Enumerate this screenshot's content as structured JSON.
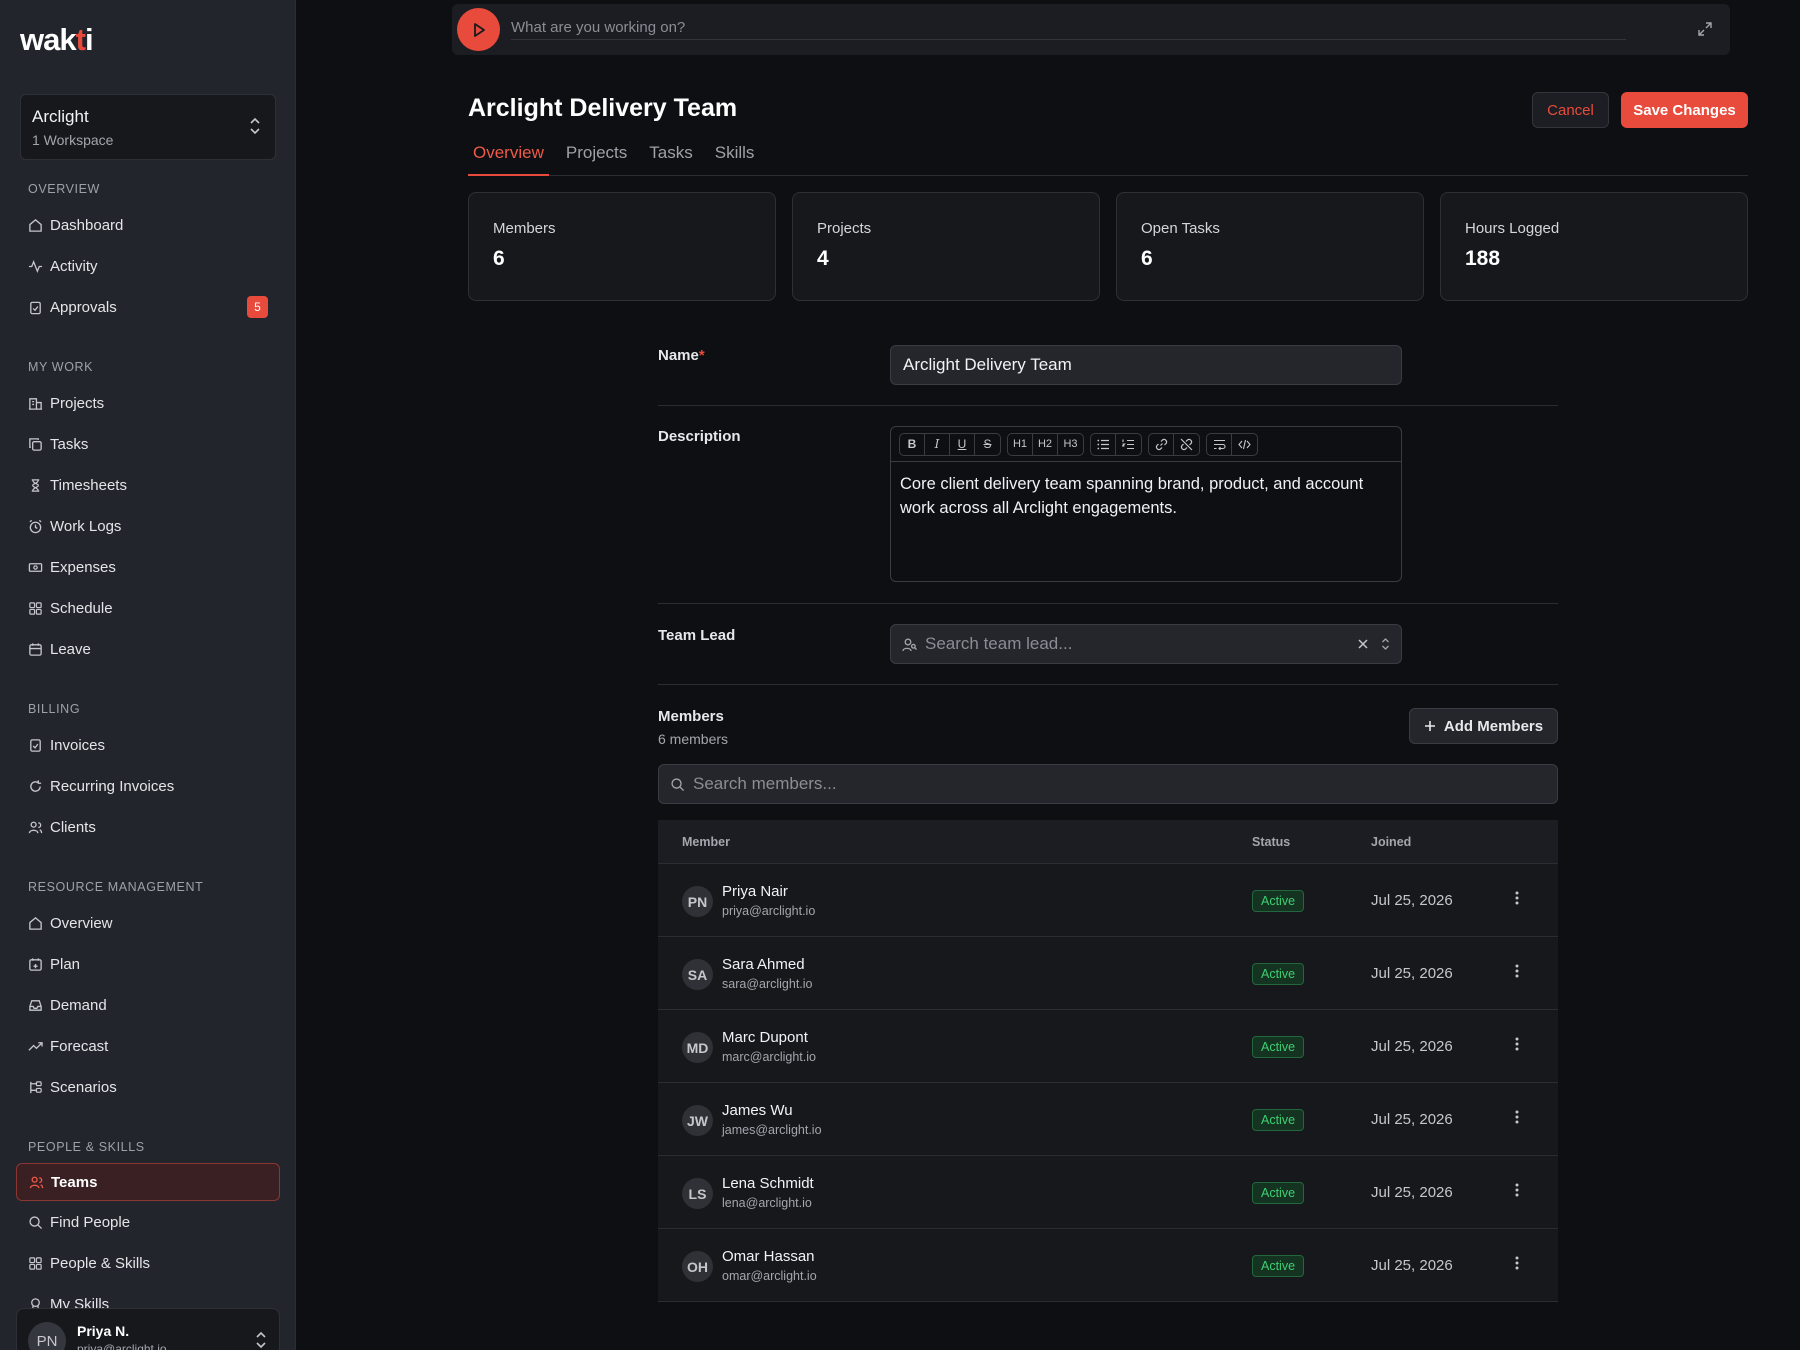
{
  "app": {
    "logo": "wakti"
  },
  "workspace": {
    "name": "Arclight",
    "sub": "1 Workspace"
  },
  "sidebar": {
    "sections": [
      "Overview",
      "My Work",
      "Billing",
      "Resource Management",
      "People & Skills"
    ],
    "items": [
      {
        "label": "Dashboard",
        "icon": "home-icon"
      },
      {
        "label": "Activity",
        "icon": "activity-icon"
      },
      {
        "label": "Approvals",
        "icon": "clipboard-check-icon",
        "badge": "5"
      },
      {
        "label": "Projects",
        "icon": "building-icon"
      },
      {
        "label": "Tasks",
        "icon": "copy-icon"
      },
      {
        "label": "Timesheets",
        "icon": "hourglass-icon"
      },
      {
        "label": "Work Logs",
        "icon": "alarm-clock-icon"
      },
      {
        "label": "Expenses",
        "icon": "banknote-icon"
      },
      {
        "label": "Schedule",
        "icon": "grid-icon"
      },
      {
        "label": "Leave",
        "icon": "calendar-icon"
      },
      {
        "label": "Invoices",
        "icon": "receipt-icon"
      },
      {
        "label": "Recurring Invoices",
        "icon": "refresh-icon"
      },
      {
        "label": "Clients",
        "icon": "users-icon"
      },
      {
        "label": "Overview",
        "icon": "home-icon"
      },
      {
        "label": "Plan",
        "icon": "calendar-plus-icon"
      },
      {
        "label": "Demand",
        "icon": "inbox-icon"
      },
      {
        "label": "Forecast",
        "icon": "trending-up-icon"
      },
      {
        "label": "Scenarios",
        "icon": "git-branch-icon"
      },
      {
        "label": "Teams",
        "icon": "team-icon"
      },
      {
        "label": "Find People",
        "icon": "search-icon"
      },
      {
        "label": "People & Skills",
        "icon": "grid-icon"
      },
      {
        "label": "My Skills",
        "icon": "award-icon"
      }
    ],
    "user": {
      "initials": "PN",
      "name": "Priya N.",
      "email": "priya@arclight.io"
    }
  },
  "timer": {
    "placeholder": "What are you working on?"
  },
  "header": {
    "title": "Arclight Delivery Team",
    "cancel_label": "Cancel",
    "save_label": "Save Changes",
    "tabs": [
      "Overview",
      "Projects",
      "Tasks",
      "Skills"
    ]
  },
  "stats": [
    {
      "label": "Members",
      "value": "6"
    },
    {
      "label": "Projects",
      "value": "4"
    },
    {
      "label": "Open Tasks",
      "value": "6"
    },
    {
      "label": "Hours Logged",
      "value": "188"
    }
  ],
  "form": {
    "name_label": "Name",
    "required_mark": "*",
    "name_value": "Arclight Delivery Team",
    "description_label": "Description",
    "description_value": "Core client delivery team spanning brand, product, and account work across all Arclight engagements.",
    "toolbar": [
      "B",
      "I",
      "U",
      "S",
      "H1",
      "H2",
      "H3",
      "bullet-list",
      "ordered-list",
      "link",
      "unlink",
      "hard-break",
      "code"
    ],
    "team_lead_label": "Team Lead",
    "team_lead_placeholder": "Search team lead..."
  },
  "members": {
    "title": "Members",
    "count_text": "6 members",
    "add_label": "Add Members",
    "search_placeholder": "Search members...",
    "columns": [
      "Member",
      "Status",
      "Joined"
    ],
    "rows": [
      {
        "initials": "PN",
        "name": "Priya Nair",
        "email": "priya@arclight.io",
        "status": "Active",
        "joined": "Jul 25, 2026"
      },
      {
        "initials": "SA",
        "name": "Sara Ahmed",
        "email": "sara@arclight.io",
        "status": "Active",
        "joined": "Jul 25, 2026"
      },
      {
        "initials": "MD",
        "name": "Marc Dupont",
        "email": "marc@arclight.io",
        "status": "Active",
        "joined": "Jul 25, 2026"
      },
      {
        "initials": "JW",
        "name": "James Wu",
        "email": "james@arclight.io",
        "status": "Active",
        "joined": "Jul 25, 2026"
      },
      {
        "initials": "LS",
        "name": "Lena Schmidt",
        "email": "lena@arclight.io",
        "status": "Active",
        "joined": "Jul 25, 2026"
      },
      {
        "initials": "OH",
        "name": "Omar Hassan",
        "email": "omar@arclight.io",
        "status": "Active",
        "joined": "Jul 25, 2026"
      }
    ]
  },
  "colors": {
    "accent": "#e84b3c",
    "status_active": "#3fcf73",
    "sidebar_bg": "#23252c",
    "page_bg": "#0e0f12"
  }
}
